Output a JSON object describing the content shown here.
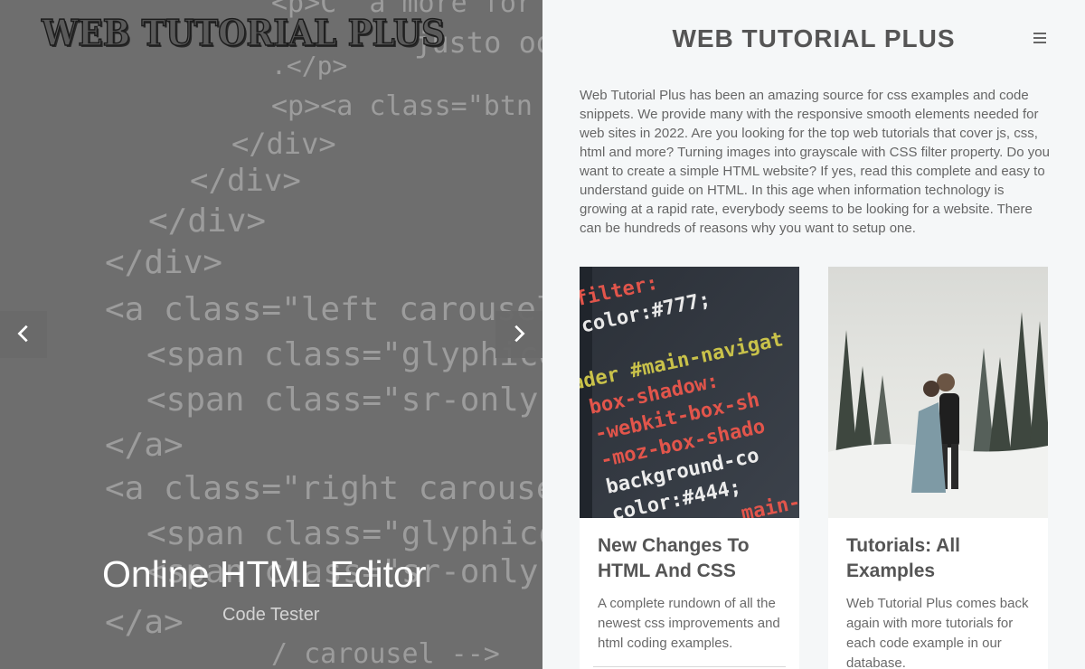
{
  "hero": {
    "logo": "WEB TUTORIAL PLUS",
    "slide_title": "Online HTML Editor",
    "slide_subtitle": "Code Tester",
    "prev_icon": "chevron-left-icon",
    "next_icon": "chevron-right-icon",
    "code_lines": [
      "<p>C  a more for",
      "justo od",
      ".</p>",
      "<p><a class=\"btn",
      "</div>",
      "</div>",
      "</div>",
      "</div>",
      "<a class=\"left carousel",
      "<span class=\"glyphicon",
      "<span class=\"sr-only\">P",
      "</a>",
      "<a class=\"right carousel",
      "<span class=\"glyphicon",
      "<span class=\"sr-only\">N",
      "</a>",
      "/ carousel -->"
    ]
  },
  "panel": {
    "title": "WEB TUTORIAL PLUS",
    "menu_icon": "hamburger-menu-icon",
    "intro": "Web Tutorial Plus has been an amazing source for css examples and code snippets. We provide many with the responsive smooth elements needed for web sites in 2022. Are you looking for the top web tutorials that cover js, css, html and more? Turning images into grayscale with CSS filter property. Do you want to create a simple HTML website? If yes, read this complete and easy to understand guide on HTML. In this age when information technology is growing at a rapid rate, everybody seems to be looking for a website. There can be hundreds of reasons why you want to setup one."
  },
  "cards": [
    {
      "title": "New Changes To HTML And CSS",
      "text": "A complete rundown of all the newest css improvements and html coding examples.",
      "image_lines": [
        "filter:",
        "color:#777;",
        "header #main-navigat",
        "box-shadow:",
        "-webkit-box-sh",
        "-moz-box-shado",
        "background-co",
        "color:#444;",
        "main-na"
      ]
    },
    {
      "title": "Tutorials: All Examples",
      "text": "Web Tutorial Plus comes back again with more tutorials for each code example in our database."
    }
  ],
  "colors": {
    "hero_overlay": "#6e6e6e",
    "panel_bg": "#f5f7f8",
    "title_text": "#555555",
    "body_text": "#666666"
  }
}
